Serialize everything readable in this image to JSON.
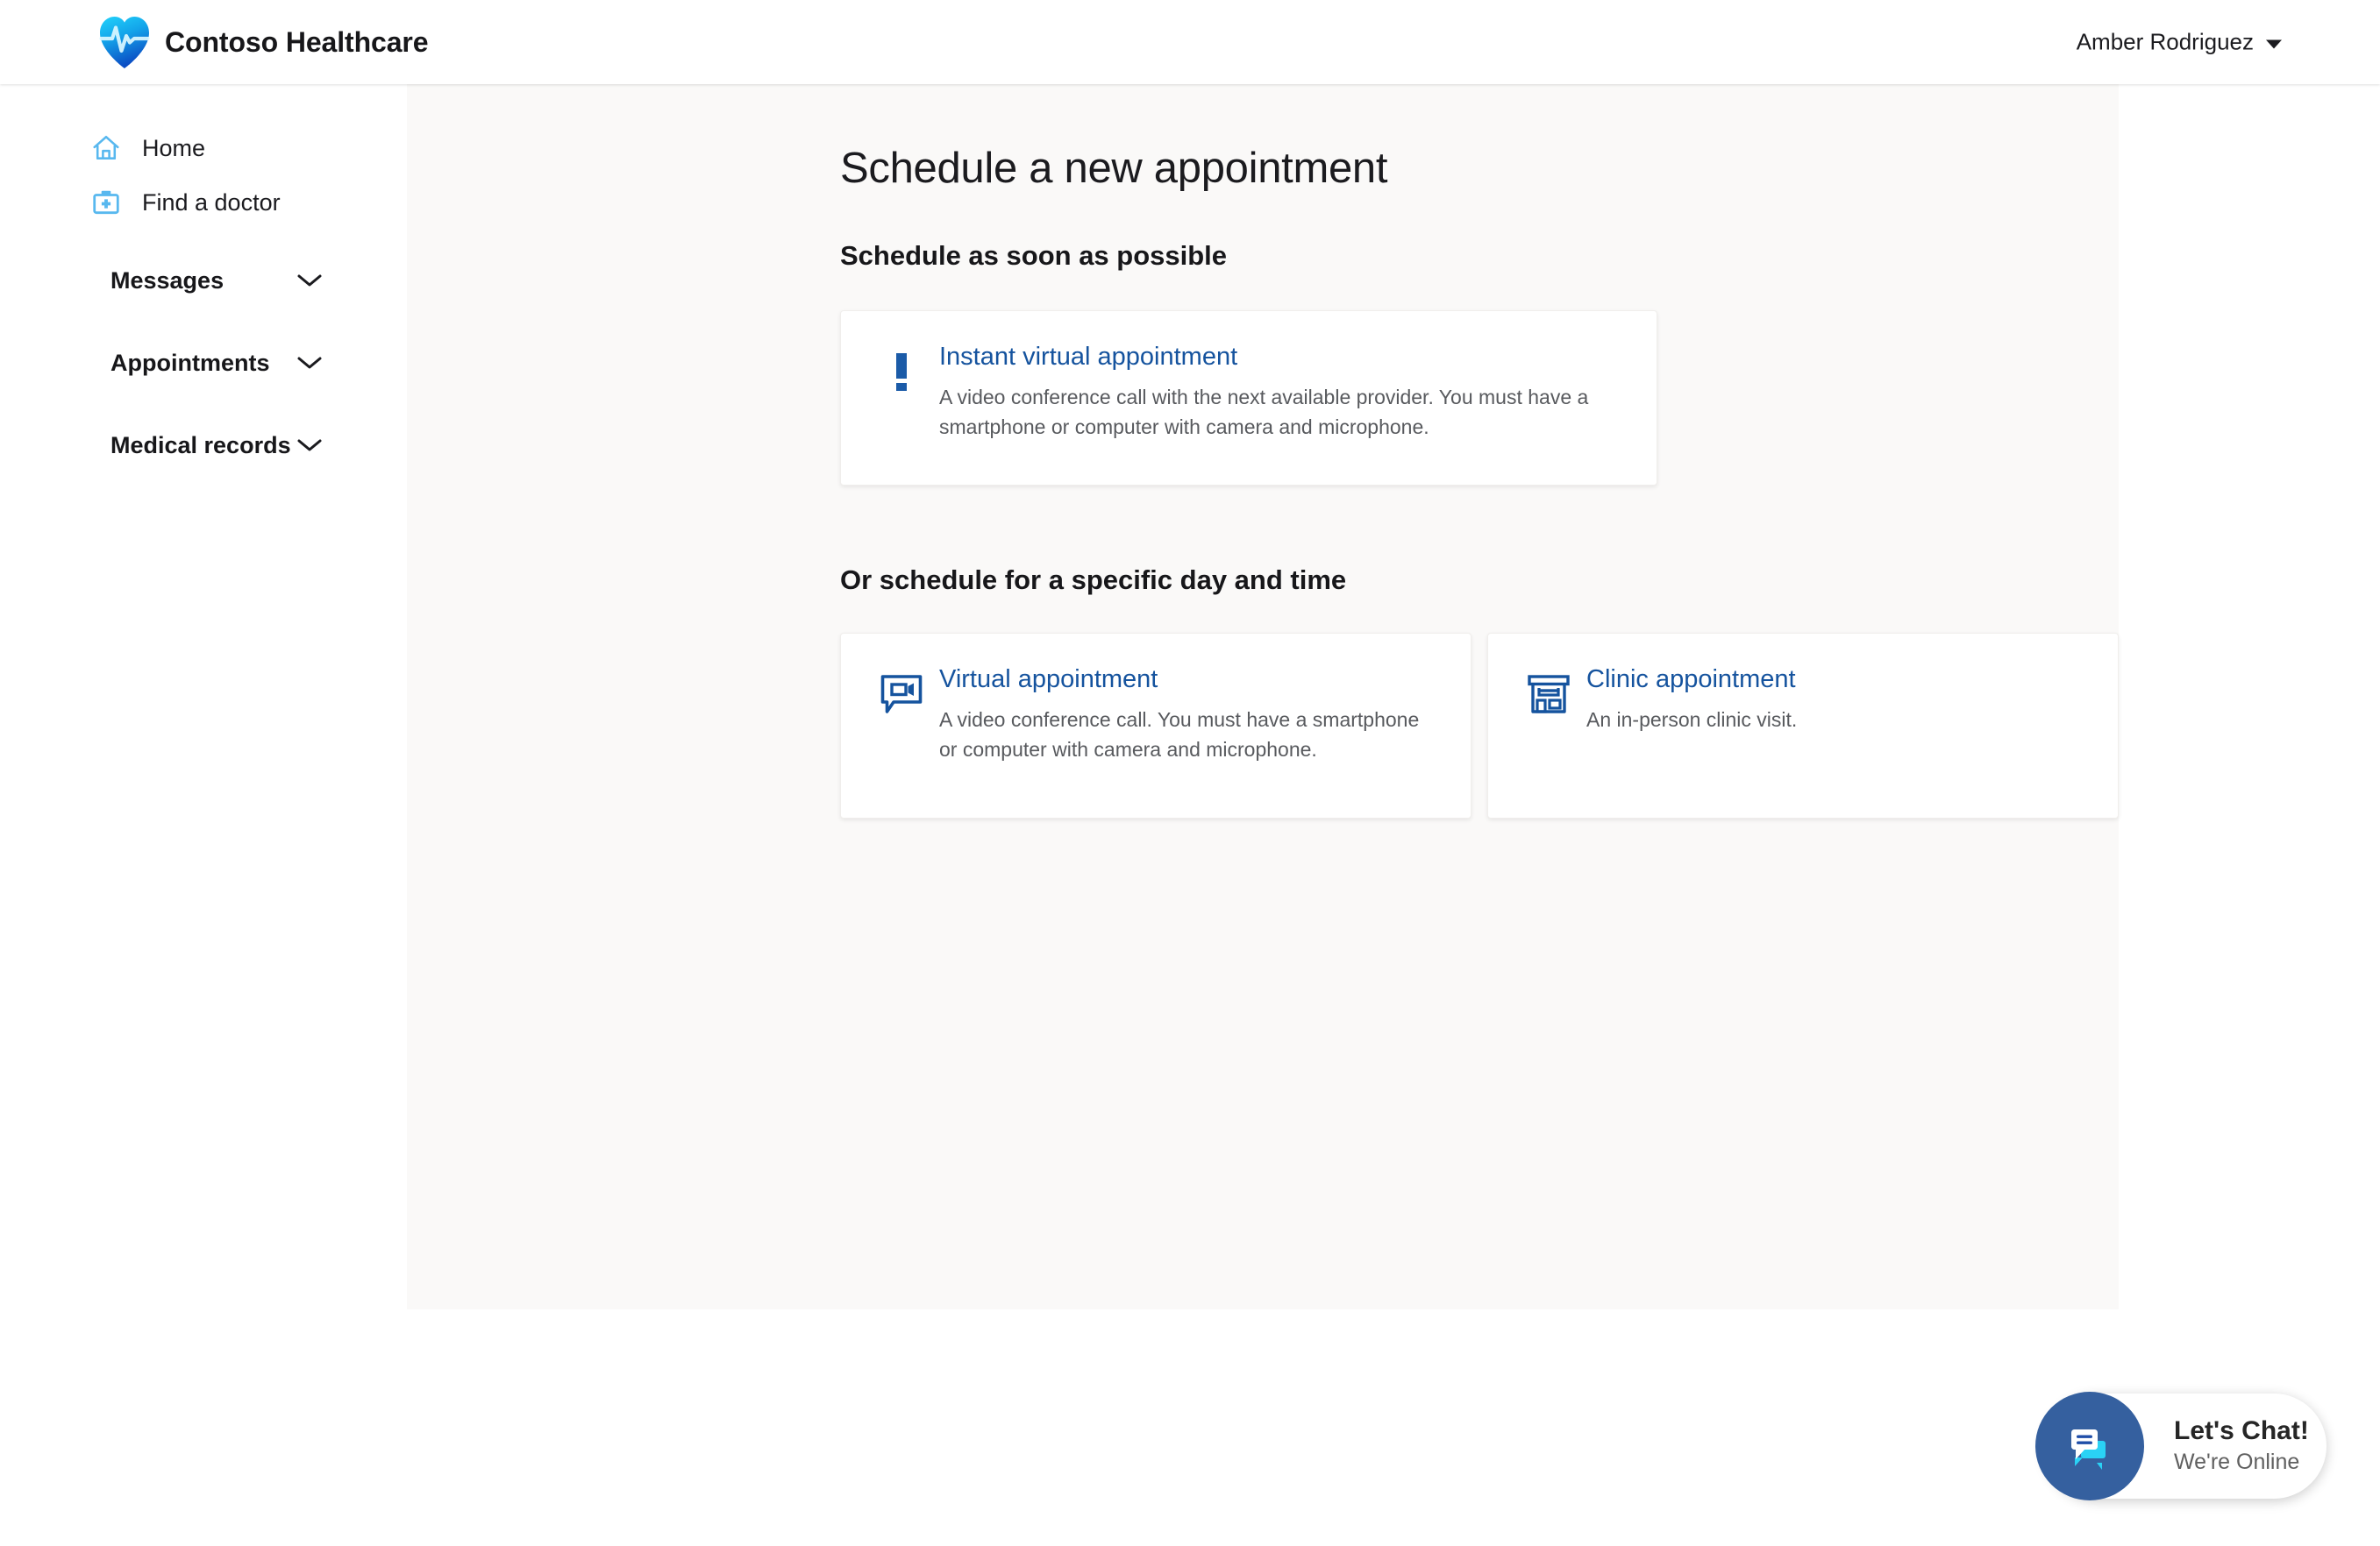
{
  "header": {
    "brand_name": "Contoso Healthcare",
    "logo_icon": "heart-pulse-logo",
    "user_name": "Amber Rodriguez",
    "user_caret_icon": "caret-down-icon"
  },
  "sidebar": {
    "links": [
      {
        "label": "Home",
        "icon": "home-icon"
      },
      {
        "label": "Find a doctor",
        "icon": "doctor-bag-icon"
      }
    ],
    "groups": [
      {
        "label": "Messages",
        "icon": "chevron-down-icon"
      },
      {
        "label": "Appointments",
        "icon": "chevron-down-icon"
      },
      {
        "label": "Medical records",
        "icon": "chevron-down-icon"
      }
    ]
  },
  "main": {
    "page_title": "Schedule a new appointment",
    "sections": [
      {
        "heading": "Schedule as soon as possible"
      },
      {
        "heading": "Or schedule for a specific day and time"
      }
    ],
    "cards": {
      "instant": {
        "icon": "exclamation-icon",
        "title": "Instant virtual appointment",
        "description": "A video conference call with the next available provider. You must have a smartphone or computer with camera and microphone."
      },
      "virtual": {
        "icon": "video-chat-icon",
        "title": "Virtual appointment",
        "description": "A video conference call. You must have a smartphone or computer with camera and microphone."
      },
      "clinic": {
        "icon": "clinic-building-icon",
        "title": "Clinic appointment",
        "description": "An in-person clinic visit."
      }
    }
  },
  "chat": {
    "icon": "chat-bubbles-icon",
    "title": "Let's Chat!",
    "status": "We're Online"
  },
  "colors": {
    "brand_blue": "#15539e",
    "icon_light_blue": "#58b8ef",
    "content_bg": "#faf9f8",
    "chat_circle": "#35609f",
    "chat_accent_cyan": "#2ad2f5",
    "text_primary": "#1b1b1f",
    "text_secondary": "#585a5e"
  }
}
